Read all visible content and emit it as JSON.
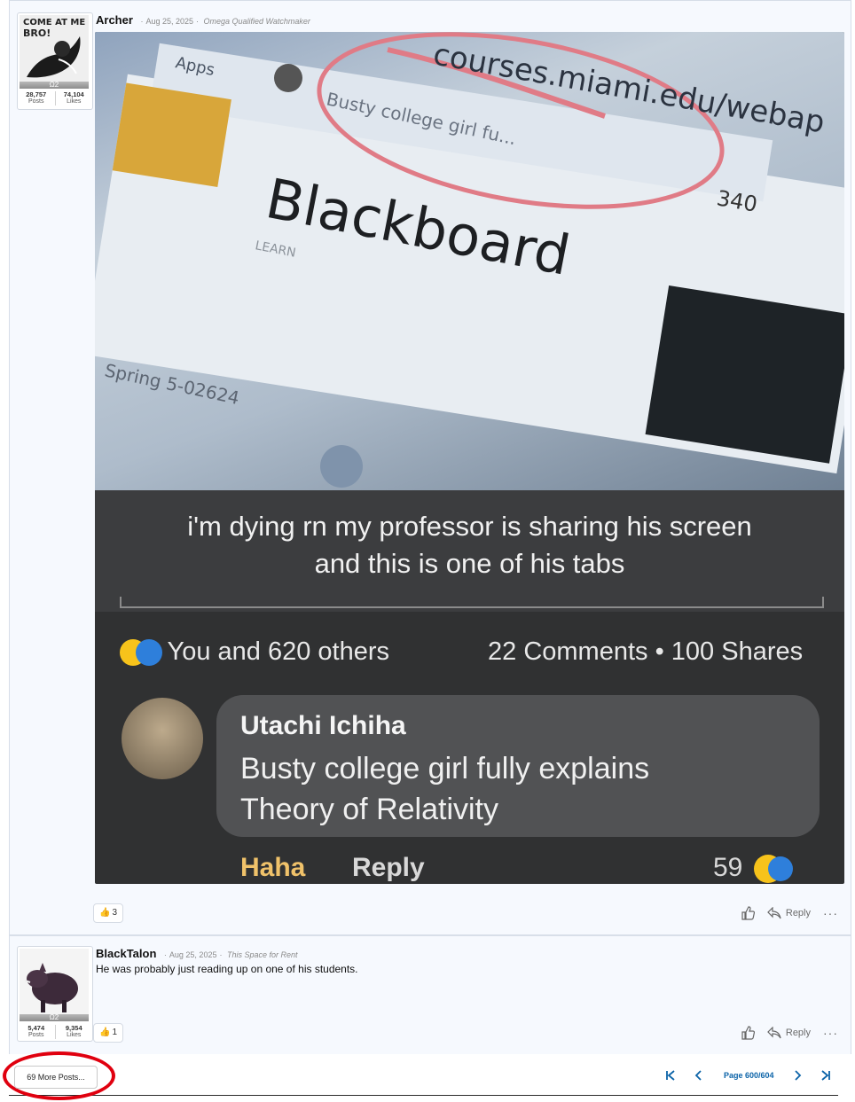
{
  "posts": [
    {
      "username": "Archer",
      "date": "Aug 25, 2025",
      "user_title": "Omega Qualified Watchmaker",
      "avatar_text": "COME AT ME BRO!",
      "level": "Ω2",
      "stats": {
        "posts": "28,757",
        "posts_label": "Posts",
        "likes": "74,104",
        "likes_label": "Likes"
      },
      "reaction_count": "3",
      "reply_label": "Reply",
      "more_label": "···",
      "image": {
        "url_text": "courses.miami.edu/webap",
        "tab_text": "Busty college girl fu...",
        "apps_text": "Apps",
        "tab_count": "340",
        "brand": "Blackboard",
        "brand_sub": "LEARN",
        "course_code": "Spring 5-02624",
        "caption_line1": "i'm dying rn my professor is sharing his screen",
        "caption_line2": "and this is one of his tabs",
        "reactions_text": "You and 620 others",
        "comments_text": "22 Comments • 100 Shares",
        "commenter": "Utachi Ichiha",
        "comment_line1": "Busty college girl fully explains",
        "comment_line2": "Theory of Relativity",
        "haha": "Haha",
        "reply": "Reply",
        "comment_reactions": "59"
      }
    },
    {
      "username": "BlackTalon",
      "date": "Aug 25, 2025",
      "user_title": "This Space for Rent",
      "level": "Ω2",
      "stats": {
        "posts": "5,474",
        "posts_label": "Posts",
        "likes": "9,354",
        "likes_label": "Likes"
      },
      "text": "He was probably just reading up on one of his students.",
      "reaction_count": "1",
      "reply_label": "Reply",
      "more_label": "···"
    }
  ],
  "footer": {
    "more_posts": "69 More Posts...",
    "page_label": "Page 600/604"
  },
  "colors": {
    "accent": "#0b63a8",
    "highlight_circle": "#e0000f",
    "photo_bg": "#303132"
  },
  "icons": [
    "first-page-icon",
    "prev-page-icon",
    "next-page-icon",
    "last-page-icon",
    "like-icon",
    "reply-icon"
  ]
}
